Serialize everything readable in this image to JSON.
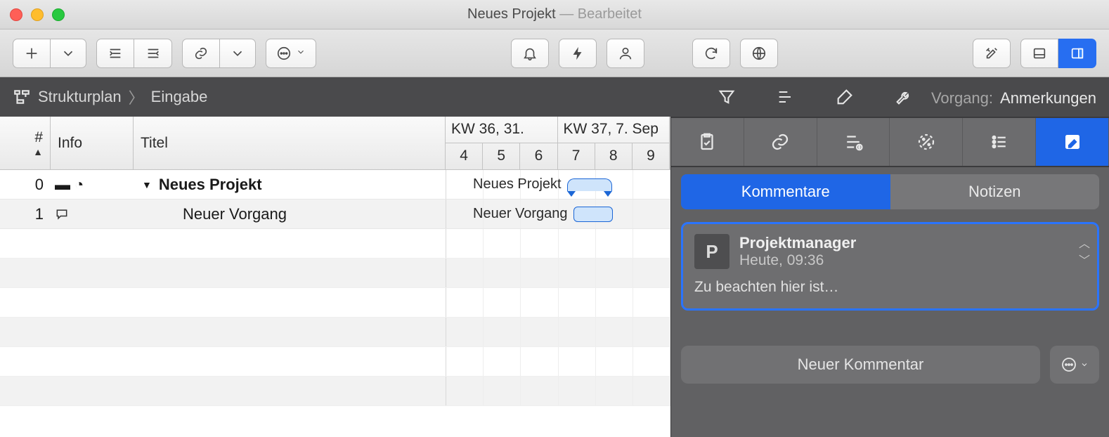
{
  "window": {
    "title": "Neues Projekt",
    "status": "Bearbeitet"
  },
  "breadcrumb": {
    "root": "Strukturplan",
    "current": "Eingabe"
  },
  "inspector": {
    "label": "Vorgang:",
    "section": "Anmerkungen",
    "subtabs": {
      "comments": "Kommentare",
      "notes": "Notizen"
    },
    "new_comment_label": "Neuer Kommentar"
  },
  "columns": {
    "num": "#",
    "info": "Info",
    "title": "Titel"
  },
  "timeline": {
    "weeks": [
      "KW 36, 31.",
      "KW 37, 7. Sep"
    ],
    "days": [
      "4",
      "5",
      "6",
      "7",
      "8",
      "9"
    ]
  },
  "rows": [
    {
      "num": "0",
      "title": "Neues Projekt",
      "bold": true,
      "gantt_label": "Neues Projekt",
      "info_icons": [
        "folder",
        "clock"
      ],
      "summary": true
    },
    {
      "num": "1",
      "title": "Neuer Vorgang",
      "bold": false,
      "gantt_label": "Neuer Vorgang",
      "info_icons": [
        "comment"
      ],
      "summary": false
    }
  ],
  "comment": {
    "avatar_letter": "P",
    "author": "Projektmanager",
    "time": "Heute, 09:36",
    "body": "Zu beachten hier ist…"
  }
}
